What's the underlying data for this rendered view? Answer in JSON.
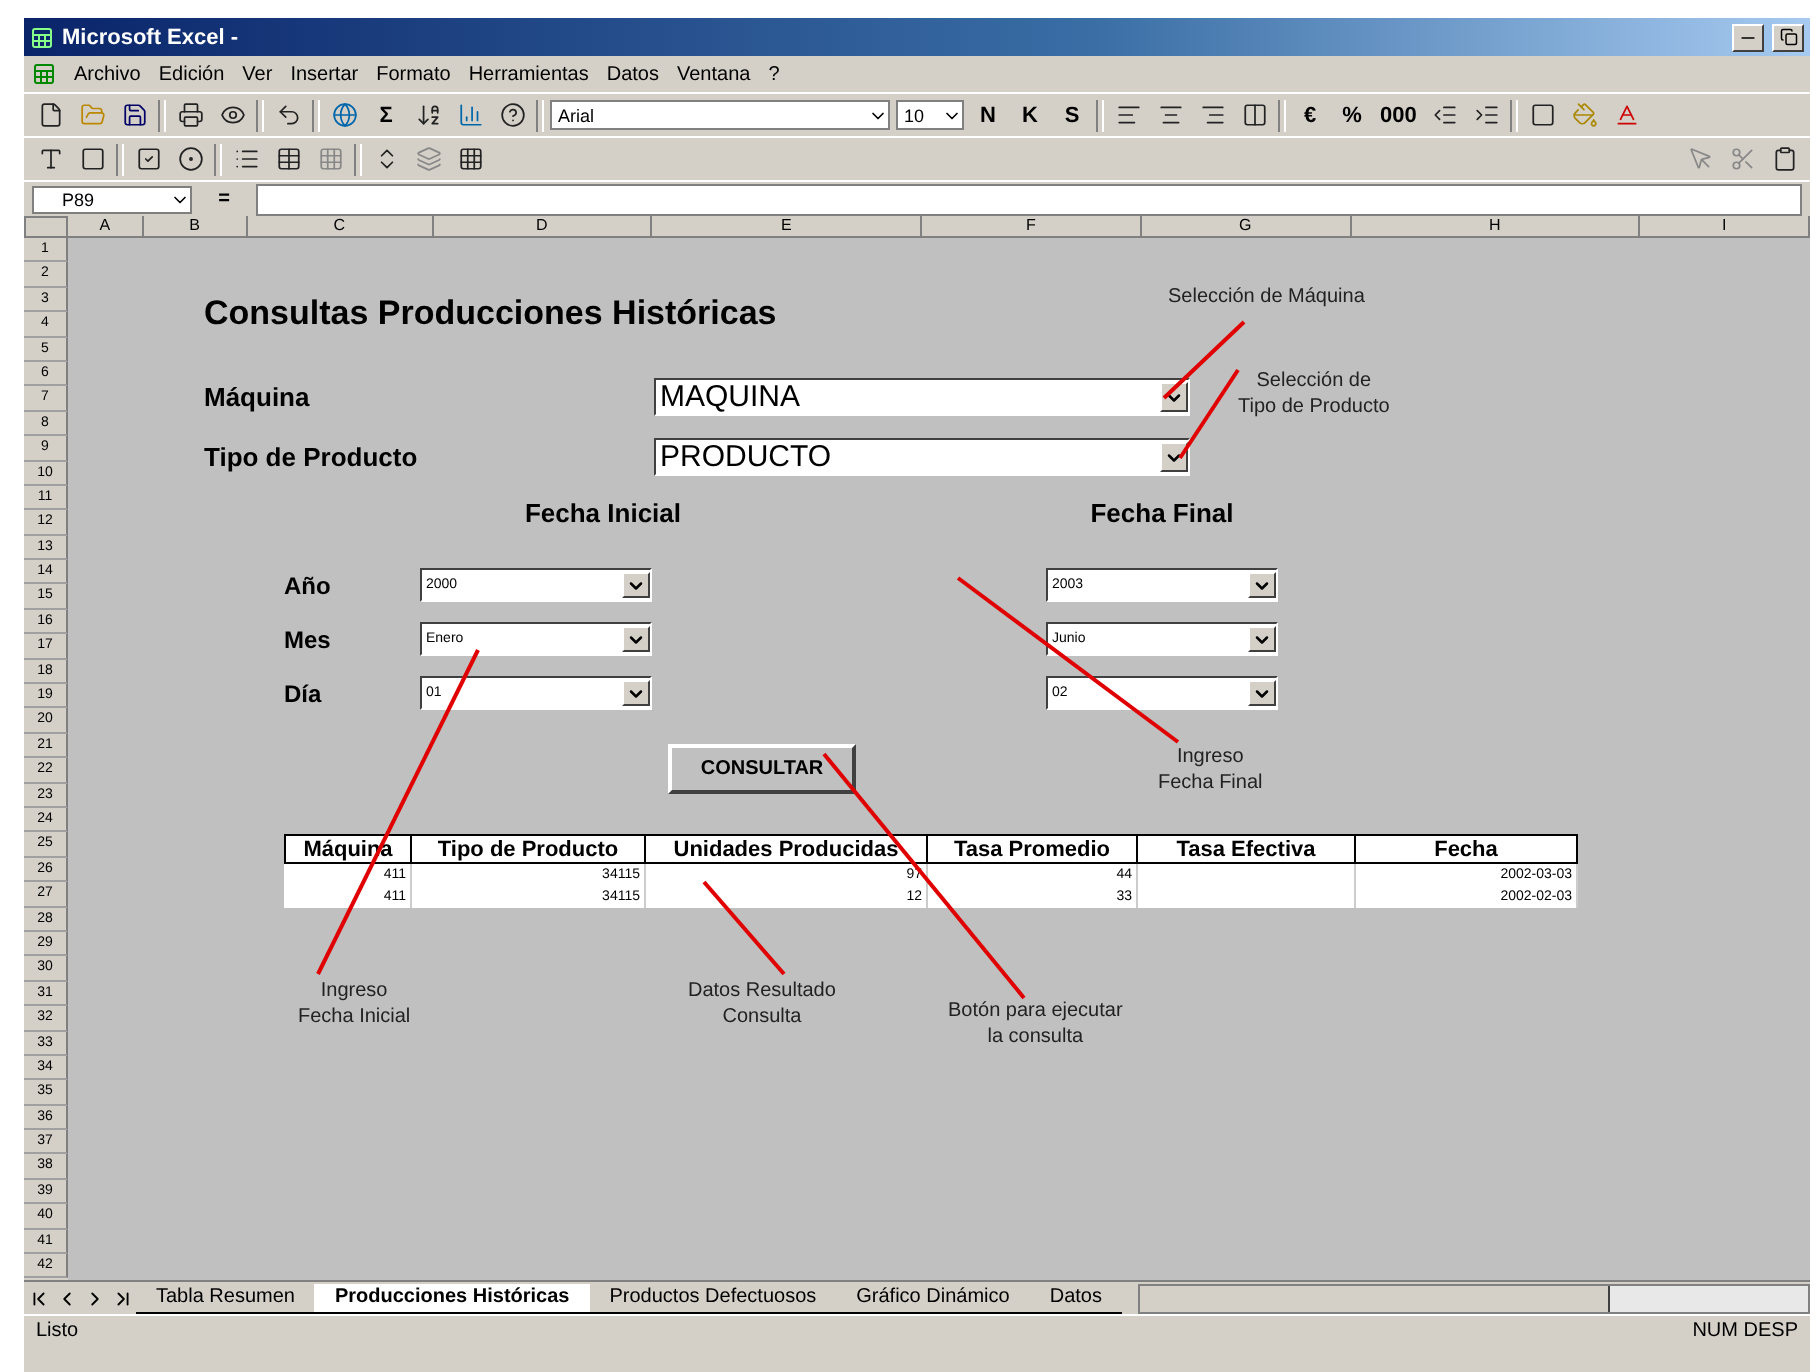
{
  "window": {
    "title": "Microsoft Excel -"
  },
  "menu": [
    "Archivo",
    "Edición",
    "Ver",
    "Insertar",
    "Formato",
    "Herramientas",
    "Datos",
    "Ventana",
    "?"
  ],
  "toolbar": {
    "sigma": "Σ",
    "font": "Arial",
    "size": "10",
    "format_buttons": [
      "N",
      "K",
      "S"
    ],
    "number_buttons": [
      "€",
      "%",
      "000"
    ]
  },
  "formula_bar": {
    "name_box": "P89",
    "equals": "="
  },
  "columns": [
    "A",
    "B",
    "C",
    "D",
    "E",
    "F",
    "G",
    "H",
    "I"
  ],
  "rows": [
    "1",
    "2",
    "3",
    "4",
    "5",
    "6",
    "7",
    "8",
    "9",
    "10",
    "11",
    "12",
    "13",
    "14",
    "15",
    "16",
    "17",
    "18",
    "19",
    "20",
    "21",
    "22",
    "23",
    "24",
    "25",
    "26",
    "27",
    "28",
    "29",
    "30",
    "31",
    "32",
    "33",
    "34",
    "35",
    "36",
    "37",
    "38",
    "39",
    "40",
    "41",
    "42"
  ],
  "form": {
    "title": "Consultas Producciones Históricas",
    "selectors": [
      {
        "label": "Máquina",
        "value": "MAQUINA"
      },
      {
        "label": "Tipo de Producto",
        "value": "PRODUCTO"
      }
    ],
    "date_groups": [
      {
        "heading": "Fecha Inicial",
        "fields": [
          {
            "label": "Año",
            "value": "2000"
          },
          {
            "label": "Mes",
            "value": "Enero"
          },
          {
            "label": "Día",
            "value": "01"
          }
        ]
      },
      {
        "heading": "Fecha Final",
        "fields": [
          {
            "value": "2003"
          },
          {
            "value": "Junio"
          },
          {
            "value": "02"
          }
        ]
      }
    ],
    "button": "CONSULTAR"
  },
  "table": {
    "columns": [
      "Máquina",
      "Tipo de Producto",
      "Unidades Producidas",
      "Tasa Promedio",
      "Tasa Efectiva",
      "Fecha"
    ],
    "rows": [
      [
        "411",
        "34115",
        "97",
        "44",
        "",
        "2002-03-03"
      ],
      [
        "411",
        "34115",
        "12",
        "33",
        "",
        "2002-02-03"
      ]
    ]
  },
  "annotations": [
    "Selección de Máquina",
    "Selección de\nTipo de Producto",
    "Ingreso\nFecha Final",
    "Ingreso\nFecha Inicial",
    "Datos Resultado\nConsulta",
    "Botón para ejecutar\nla consulta"
  ],
  "sheet_tabs": [
    {
      "label": "Tabla Resumen",
      "selected": false
    },
    {
      "label": "Producciones Históricas",
      "selected": true
    },
    {
      "label": "Productos Defectuosos",
      "selected": false
    },
    {
      "label": "Gráfico Dinámico",
      "selected": false
    },
    {
      "label": "Datos",
      "selected": false
    }
  ],
  "status_bar": {
    "left": "Listo",
    "right": "NUM DESP"
  }
}
